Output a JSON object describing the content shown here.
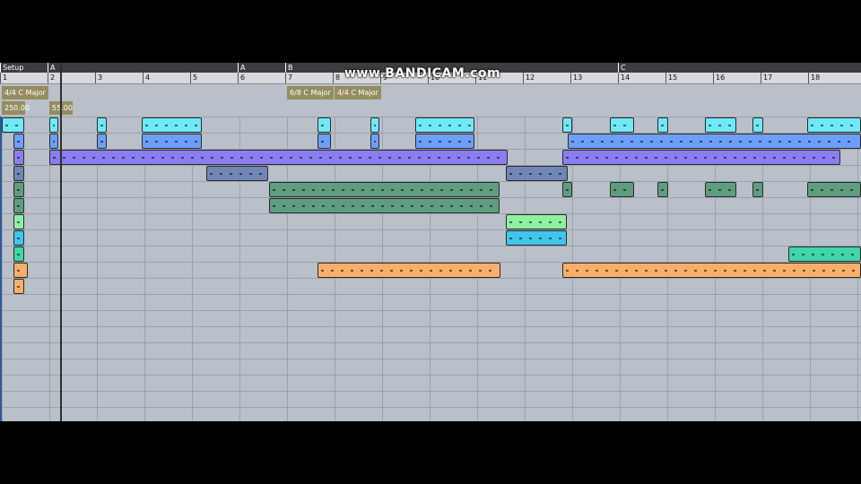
{
  "watermark": "www.BANDICAM.com",
  "sections": [
    {
      "label": "Setup",
      "bar": 0
    },
    {
      "label": "A",
      "bar": 1
    },
    {
      "label": "A",
      "bar": 5
    },
    {
      "label": "B",
      "bar": 6
    },
    {
      "label": "C",
      "bar": 13
    }
  ],
  "bars": [
    "1",
    "2",
    "3",
    "4",
    "5",
    "6",
    "7",
    "8",
    "9",
    "10",
    "11",
    "12",
    "13",
    "14",
    "15",
    "16",
    "17",
    "18"
  ],
  "time_signatures": [
    {
      "label": "4/4 C Major",
      "bar": 0
    },
    {
      "label": "6/8 C Major",
      "bar": 6
    },
    {
      "label": "4/4 C Major",
      "bar": 7
    }
  ],
  "tempos": [
    {
      "label": "250.00",
      "bar": 0
    },
    {
      "label": "55.00",
      "bar": 1
    }
  ],
  "playhead_bar": 1.22,
  "colors": {
    "cyan": "#6fe9f7",
    "blue": "#6d9ef8",
    "violet": "#8a7ef0",
    "slate": "#6f86b6",
    "green": "#5f9d80",
    "lightgreen": "#8ef0a0",
    "sky": "#40c6ea",
    "teal": "#3fd6a8",
    "orange": "#f7b06a"
  },
  "clips": [
    {
      "row": 0,
      "start": 0.0,
      "end": 0.48,
      "color": "cyan"
    },
    {
      "row": 0,
      "start": 1.0,
      "end": 1.18,
      "color": "cyan"
    },
    {
      "row": 0,
      "start": 2.0,
      "end": 2.2,
      "color": "cyan"
    },
    {
      "row": 0,
      "start": 2.95,
      "end": 4.2,
      "color": "cyan"
    },
    {
      "row": 0,
      "start": 6.65,
      "end": 6.92,
      "color": "cyan"
    },
    {
      "row": 0,
      "start": 7.75,
      "end": 7.95,
      "color": "cyan"
    },
    {
      "row": 0,
      "start": 8.7,
      "end": 9.95,
      "color": "cyan"
    },
    {
      "row": 0,
      "start": 11.8,
      "end": 12.0,
      "color": "cyan"
    },
    {
      "row": 0,
      "start": 12.8,
      "end": 13.3,
      "color": "cyan"
    },
    {
      "row": 0,
      "start": 13.8,
      "end": 14.02,
      "color": "cyan"
    },
    {
      "row": 0,
      "start": 14.8,
      "end": 15.45,
      "color": "cyan"
    },
    {
      "row": 0,
      "start": 15.8,
      "end": 16.02,
      "color": "cyan"
    },
    {
      "row": 0,
      "start": 16.95,
      "end": 18.2,
      "color": "cyan"
    },
    {
      "row": 1,
      "start": 0.25,
      "end": 0.48,
      "color": "blue"
    },
    {
      "row": 1,
      "start": 1.0,
      "end": 1.18,
      "color": "blue"
    },
    {
      "row": 1,
      "start": 2.0,
      "end": 2.2,
      "color": "blue"
    },
    {
      "row": 1,
      "start": 2.95,
      "end": 4.2,
      "color": "blue"
    },
    {
      "row": 1,
      "start": 6.65,
      "end": 6.92,
      "color": "blue"
    },
    {
      "row": 1,
      "start": 7.75,
      "end": 7.95,
      "color": "blue"
    },
    {
      "row": 1,
      "start": 8.7,
      "end": 9.95,
      "color": "blue"
    },
    {
      "row": 1,
      "start": 11.9,
      "end": 18.2,
      "color": "blue"
    },
    {
      "row": 2,
      "start": 0.25,
      "end": 0.48,
      "color": "violet"
    },
    {
      "row": 2,
      "start": 1.0,
      "end": 10.65,
      "color": "violet"
    },
    {
      "row": 2,
      "start": 11.8,
      "end": 17.65,
      "color": "violet"
    },
    {
      "row": 3,
      "start": 0.25,
      "end": 0.48,
      "color": "slate"
    },
    {
      "row": 3,
      "start": 4.3,
      "end": 5.6,
      "color": "slate"
    },
    {
      "row": 3,
      "start": 10.6,
      "end": 11.9,
      "color": "slate"
    },
    {
      "row": 4,
      "start": 0.25,
      "end": 0.48,
      "color": "green"
    },
    {
      "row": 4,
      "start": 5.62,
      "end": 10.47,
      "color": "green"
    },
    {
      "row": 4,
      "start": 11.8,
      "end": 12.0,
      "color": "green"
    },
    {
      "row": 4,
      "start": 12.8,
      "end": 13.3,
      "color": "green"
    },
    {
      "row": 4,
      "start": 13.8,
      "end": 14.02,
      "color": "green"
    },
    {
      "row": 4,
      "start": 14.8,
      "end": 15.45,
      "color": "green"
    },
    {
      "row": 4,
      "start": 15.8,
      "end": 16.02,
      "color": "green"
    },
    {
      "row": 4,
      "start": 16.95,
      "end": 18.2,
      "color": "green"
    },
    {
      "row": 5,
      "start": 0.25,
      "end": 0.48,
      "color": "green"
    },
    {
      "row": 5,
      "start": 5.62,
      "end": 10.47,
      "color": "green"
    },
    {
      "row": 6,
      "start": 0.25,
      "end": 0.48,
      "color": "lightgreen"
    },
    {
      "row": 6,
      "start": 10.6,
      "end": 11.88,
      "color": "lightgreen"
    },
    {
      "row": 7,
      "start": 0.25,
      "end": 0.48,
      "color": "sky"
    },
    {
      "row": 7,
      "start": 10.6,
      "end": 11.88,
      "color": "sky"
    },
    {
      "row": 8,
      "start": 0.25,
      "end": 0.48,
      "color": "teal"
    },
    {
      "row": 8,
      "start": 16.55,
      "end": 18.2,
      "color": "teal"
    },
    {
      "row": 9,
      "start": 0.25,
      "end": 0.55,
      "color": "orange"
    },
    {
      "row": 9,
      "start": 6.65,
      "end": 10.5,
      "color": "orange"
    },
    {
      "row": 9,
      "start": 11.8,
      "end": 18.2,
      "color": "orange"
    },
    {
      "row": 10,
      "start": 0.25,
      "end": 0.48,
      "color": "orange"
    }
  ]
}
